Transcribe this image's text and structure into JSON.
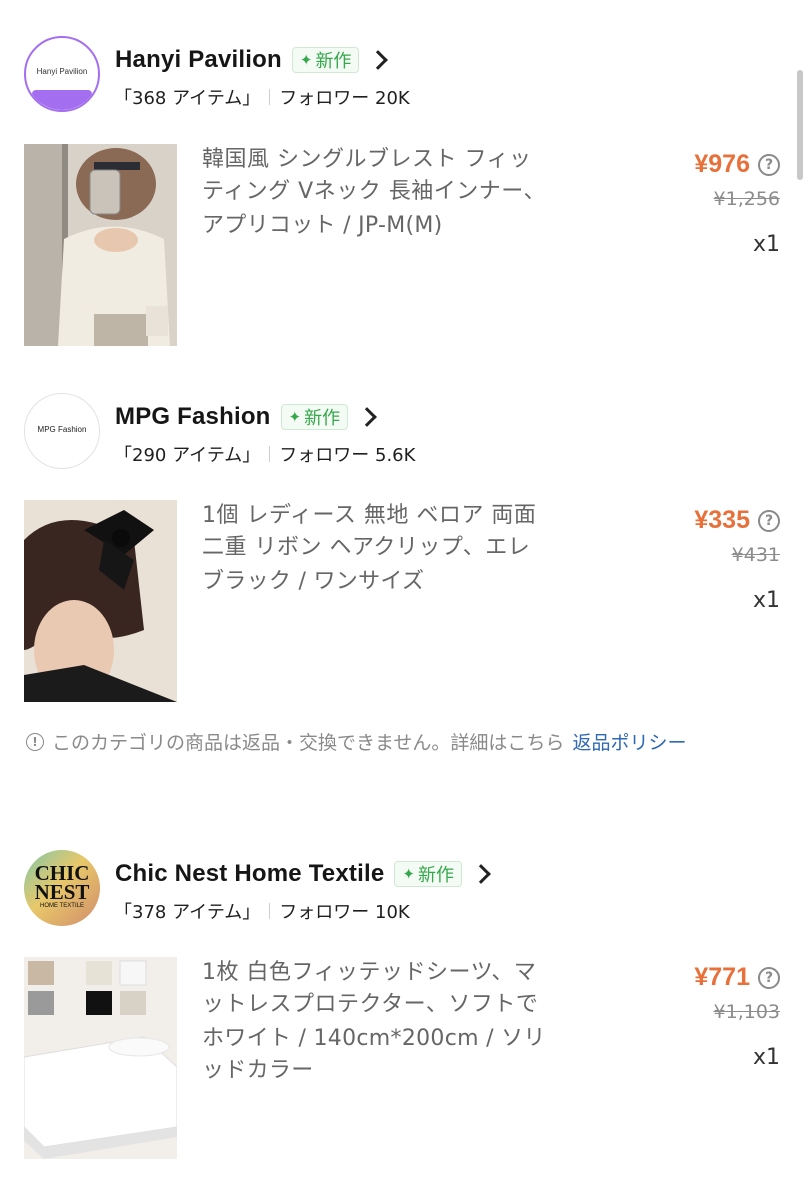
{
  "stores": [
    {
      "name": "Hanyi Pavilion",
      "logo_text": "Hanyi Pavilion",
      "badge": "新作",
      "items_text": "「368 アイテム」",
      "followers_text": "フォロワー 20K",
      "product": {
        "title": "韓国風 シングルブレスト フィッティング Vネック 長袖インナー、",
        "variant": "アプリコット / JP-M(M)",
        "price": "¥976",
        "original_price": "¥1,256",
        "quantity": "x1"
      }
    },
    {
      "name": "MPG Fashion",
      "logo_text": "MPG Fashion",
      "badge": "新作",
      "items_text": "「290 アイテム」",
      "followers_text": "フォロワー 5.6K",
      "product": {
        "title": "1個 レディース 無地 ベロア 両面二重 リボン ヘアクリップ、エレ",
        "variant": "ブラック / ワンサイズ",
        "price": "¥335",
        "original_price": "¥431",
        "quantity": "x1"
      }
    },
    {
      "name": "Chic Nest Home Textile",
      "logo_text": [
        "CHIC",
        "NEST",
        "HOME TEXTILE"
      ],
      "badge": "新作",
      "items_text": "「378 アイテム」",
      "followers_text": "フォロワー 10K",
      "product": {
        "title": "1枚 白色フィッテッドシーツ、マットレスプロテクター、ソフトで",
        "variant": "ホワイト / 140cm*200cm / ソリッドカラー",
        "price": "¥771",
        "original_price": "¥1,103",
        "quantity": "x1"
      }
    }
  ],
  "notice": {
    "text": "このカテゴリの商品は返品・交換できません。詳細はこちら",
    "link": "返品ポリシー"
  },
  "icons": {
    "badge_icon": "sparkle-icon",
    "store_arrow": "chevron-right-icon",
    "price_help": "question-circle-icon",
    "notice_icon": "exclamation-circle-icon"
  },
  "colors": {
    "price": "#e8703a",
    "badge_green": "#36a84c",
    "link_blue": "#2f68b3",
    "logo_purple": "#a46ef0"
  }
}
